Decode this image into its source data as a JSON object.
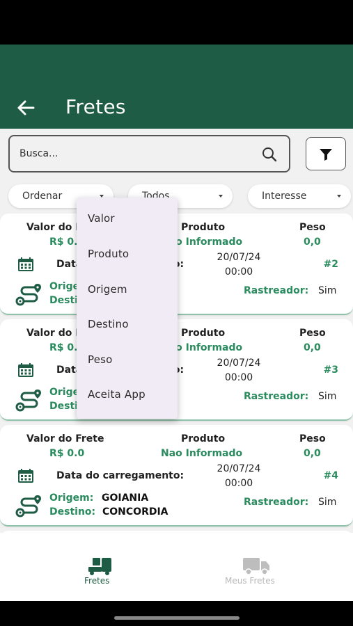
{
  "header": {
    "title": "Fretes"
  },
  "search": {
    "placeholder": "Busca..."
  },
  "sort": {
    "order_label": "Ordenar",
    "all_label": "Todos",
    "interest_label": "Interesse"
  },
  "columns": {
    "value": "Valor do Frete",
    "product": "Produto",
    "weight": "Peso",
    "loading": "Data do carregamento:",
    "origin": "Origem:",
    "destination": "Destino:",
    "tracker": "Rastreador:"
  },
  "cards": [
    {
      "value": "R$ 0.0",
      "product": "Nao Informado",
      "weight": "0,0",
      "date": "20/07/24",
      "time": "00:00",
      "number": "#2",
      "origin": "",
      "destination": "",
      "tracker": "Sim"
    },
    {
      "value": "R$ 0.0",
      "product": "Nao Informado",
      "weight": "0,0",
      "date": "20/07/24",
      "time": "00:00",
      "number": "#3",
      "origin": "",
      "destination": "",
      "tracker": "Sim"
    },
    {
      "value": "R$ 0.0",
      "product": "Nao Informado",
      "weight": "0,0",
      "date": "20/07/24",
      "time": "00:00",
      "number": "#4",
      "origin": "GOIANIA",
      "destination": "CONCORDIA",
      "tracker": "Sim"
    }
  ],
  "dropdown": {
    "items": [
      "Valor",
      "Produto",
      "Origem",
      "Destino",
      "Peso",
      "Aceita App"
    ]
  },
  "nav": {
    "fretes_label": "Fretes",
    "meus_fretes_label": "Meus Fretes"
  },
  "colors": {
    "primary": "#1f5c45",
    "accent_green": "#2a8c5e",
    "menu_bg": "#f1ebf5"
  },
  "icons": [
    "back-arrow-icon",
    "search-icon",
    "filter-icon",
    "calendar-icon",
    "route-icon",
    "truck-cargo-icon",
    "truck-icon"
  ]
}
